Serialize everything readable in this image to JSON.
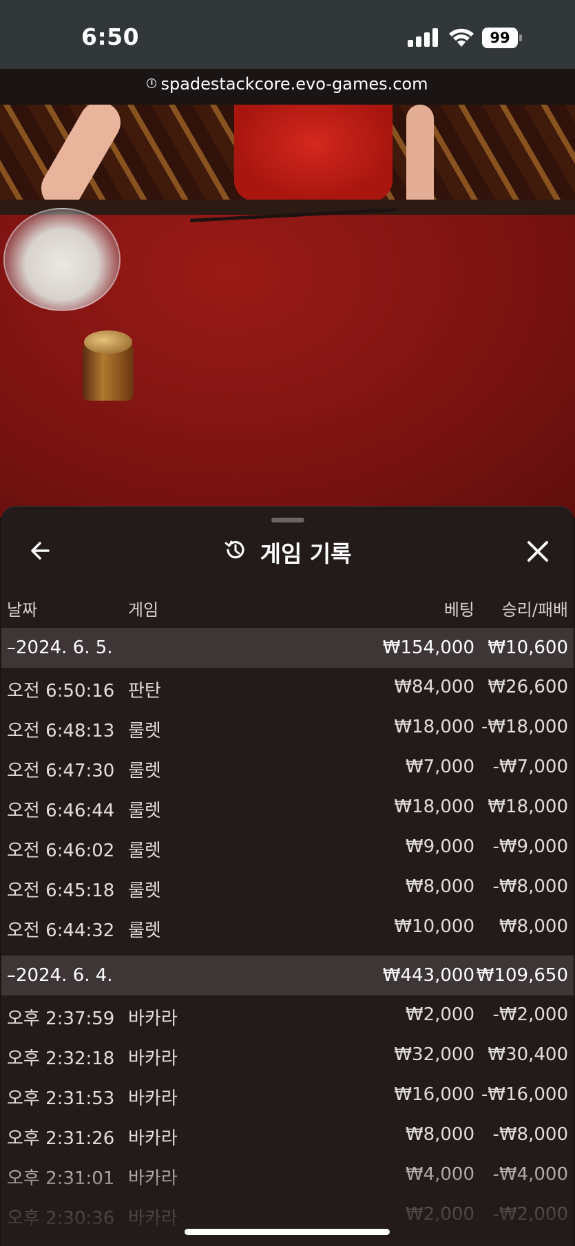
{
  "status_bar": {
    "time": "6:50",
    "battery": "99"
  },
  "browser": {
    "url": "spadestackcore.evo-games.com"
  },
  "sheet": {
    "title": "게임 기록",
    "columns": {
      "date": "날짜",
      "game": "게임",
      "bet": "베팅",
      "result": "승리/패배"
    },
    "groups": [
      {
        "date": "–2024. 6. 5.",
        "bet_total": "₩154,000",
        "result_total": "₩10,600",
        "rows": [
          {
            "time": "오전 6:50:16",
            "game": "판탄",
            "bet": "₩84,000",
            "result": "₩26,600"
          },
          {
            "time": "오전 6:48:13",
            "game": "룰렛",
            "bet": "₩18,000",
            "result": "-₩18,000"
          },
          {
            "time": "오전 6:47:30",
            "game": "룰렛",
            "bet": "₩7,000",
            "result": "-₩7,000"
          },
          {
            "time": "오전 6:46:44",
            "game": "룰렛",
            "bet": "₩18,000",
            "result": "₩18,000"
          },
          {
            "time": "오전 6:46:02",
            "game": "룰렛",
            "bet": "₩9,000",
            "result": "-₩9,000"
          },
          {
            "time": "오전 6:45:18",
            "game": "룰렛",
            "bet": "₩8,000",
            "result": "-₩8,000"
          },
          {
            "time": "오전 6:44:32",
            "game": "룰렛",
            "bet": "₩10,000",
            "result": "₩8,000"
          }
        ]
      },
      {
        "date": "–2024. 6. 4.",
        "bet_total": "₩443,000",
        "result_total": "₩109,650",
        "rows": [
          {
            "time": "오후 2:37:59",
            "game": "바카라",
            "bet": "₩2,000",
            "result": "-₩2,000"
          },
          {
            "time": "오후 2:32:18",
            "game": "바카라",
            "bet": "₩32,000",
            "result": "₩30,400"
          },
          {
            "time": "오후 2:31:53",
            "game": "바카라",
            "bet": "₩16,000",
            "result": "-₩16,000"
          },
          {
            "time": "오후 2:31:26",
            "game": "바카라",
            "bet": "₩8,000",
            "result": "-₩8,000"
          },
          {
            "time": "오후 2:31:01",
            "game": "바카라",
            "bet": "₩4,000",
            "result": "-₩4,000"
          },
          {
            "time": "오후 2:30:36",
            "game": "바카라",
            "bet": "₩2,000",
            "result": "-₩2,000"
          }
        ]
      }
    ]
  }
}
